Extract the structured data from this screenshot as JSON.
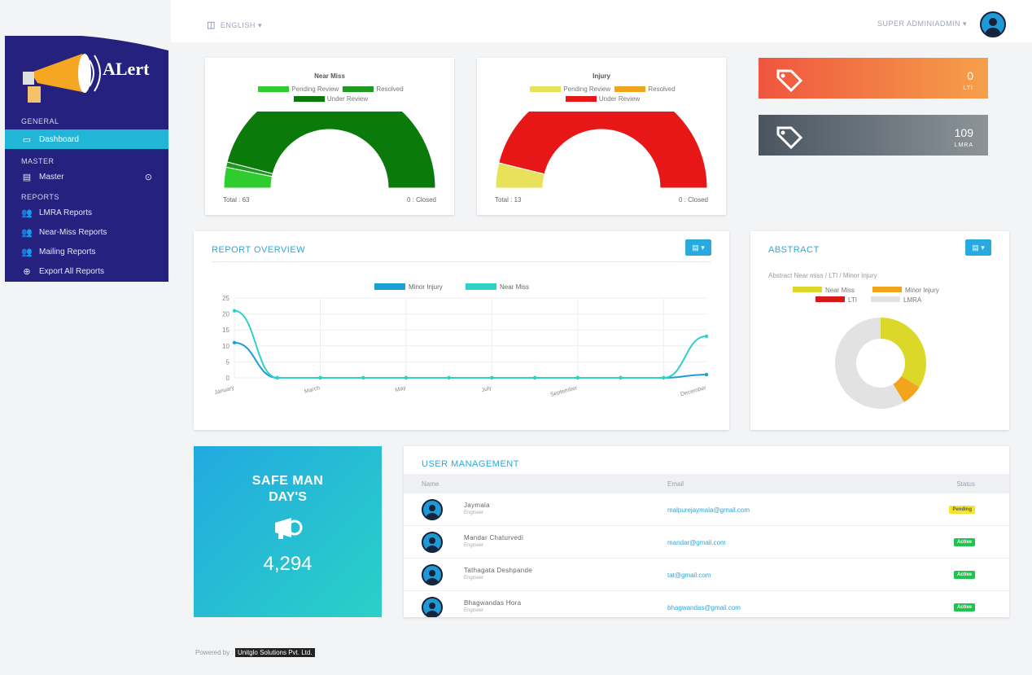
{
  "topbar": {
    "language": "ENGLISH",
    "user": "SUPER ADMINIADMIN"
  },
  "sidebar": {
    "brand": "ALert",
    "sections": {
      "general": "GENERAL",
      "master": "MASTER",
      "reports": "REPORTS"
    },
    "items": [
      {
        "label": "Dashboard",
        "icon": "monitor-icon"
      },
      {
        "label": "Master",
        "icon": "grid-icon"
      },
      {
        "label": "LMRA Reports",
        "icon": "users-icon"
      },
      {
        "label": "Near-Miss Reports",
        "icon": "users-icon"
      },
      {
        "label": "Mailing Reports",
        "icon": "users-icon"
      },
      {
        "label": "Export All Reports",
        "icon": "download-icon"
      }
    ]
  },
  "near_miss": {
    "title": "Near Miss",
    "legend": [
      "Pending Review",
      "Resolved",
      "Under Review"
    ],
    "total": "Total : 63",
    "closed": "0 : Closed",
    "colors": [
      "#2ecc2e",
      "#1e9a1e",
      "#0a7a0a"
    ]
  },
  "injury": {
    "title": "Injury",
    "legend": [
      "Pending Review",
      "Resolved",
      "Under Review"
    ],
    "total": "Total : 13",
    "closed": "0 : Closed",
    "colors": [
      "#e8e25a",
      "#f2a51c",
      "#e81717"
    ]
  },
  "stats": {
    "lti": {
      "value": "0",
      "label": "LTI"
    },
    "lmra": {
      "value": "109",
      "label": "LMRA"
    }
  },
  "report_overview": {
    "title": "REPORT OVERVIEW"
  },
  "abstract": {
    "title": "ABSTRACT",
    "subtitle": "Abstract Near miss / LTI / Minor Injury"
  },
  "safe_man_days": {
    "line1": "SAFE MAN",
    "line2": "DAY'S",
    "value": "4,294"
  },
  "user_management": {
    "title": "USER MANAGEMENT",
    "columns": [
      "Name",
      "Email",
      "Status"
    ],
    "rows": [
      {
        "name": "Jaymala",
        "role": "Engineer",
        "email": "malpurejaymala@gmail.com",
        "status": "Pending"
      },
      {
        "name": "Mandar Chaturvedi",
        "role": "Engineer",
        "email": "mandar@gmail.com",
        "status": "Active"
      },
      {
        "name": "Tathagata Deshpande",
        "role": "Engineer",
        "email": "tat@gmail.com",
        "status": "Active"
      },
      {
        "name": "Bhagwandas Hora",
        "role": "Engineer",
        "email": "bhagwandas@gmail.com",
        "status": "Active"
      }
    ]
  },
  "footer": {
    "powered_by": "Powered by :",
    "company": "Unitglo Solutions Pvt. Ltd."
  },
  "chart_data": [
    {
      "type": "pie",
      "title": "Near Miss",
      "labels": [
        "Pending Review",
        "Resolved",
        "Under Review"
      ],
      "values": [
        4,
        1,
        58
      ],
      "colors": [
        "#2ecc2e",
        "#1e9a1e",
        "#0a7a0a"
      ]
    },
    {
      "type": "pie",
      "title": "Injury",
      "labels": [
        "Pending Review",
        "Resolved",
        "Under Review"
      ],
      "values": [
        1,
        0,
        12
      ],
      "colors": [
        "#e8e25a",
        "#f2a51c",
        "#e81717"
      ]
    },
    {
      "type": "line",
      "categories": [
        "January",
        "February",
        "March",
        "April",
        "May",
        "June",
        "July",
        "August",
        "September",
        "October",
        "November",
        "December"
      ],
      "x_tick_labels": [
        "January",
        "March",
        "May",
        "July",
        "September",
        "December"
      ],
      "series": [
        {
          "name": "Minor Injury",
          "color": "#1e9fd8",
          "values": [
            11,
            0,
            0,
            0,
            0,
            0,
            0,
            0,
            0,
            0,
            0,
            1
          ]
        },
        {
          "name": "Near Miss",
          "color": "#2fd1c4",
          "values": [
            21,
            0,
            0,
            0,
            0,
            0,
            0,
            0,
            0,
            0,
            0,
            13
          ]
        }
      ],
      "ylim": [
        0,
        25
      ],
      "yticks": [
        0,
        5,
        10,
        15,
        20,
        25
      ],
      "grid": true,
      "legend": "top-center"
    },
    {
      "type": "pie",
      "subtitle": "Abstract Near miss / LTI / Minor Injury",
      "donut": true,
      "labels": [
        "Near Miss",
        "Minor Injury",
        "LTI",
        "LMRA"
      ],
      "values": [
        63,
        14,
        0,
        109
      ],
      "colors": [
        "#dbd82a",
        "#f2a51c",
        "#d81818",
        "#e2e2e2"
      ],
      "legend": "top"
    }
  ]
}
